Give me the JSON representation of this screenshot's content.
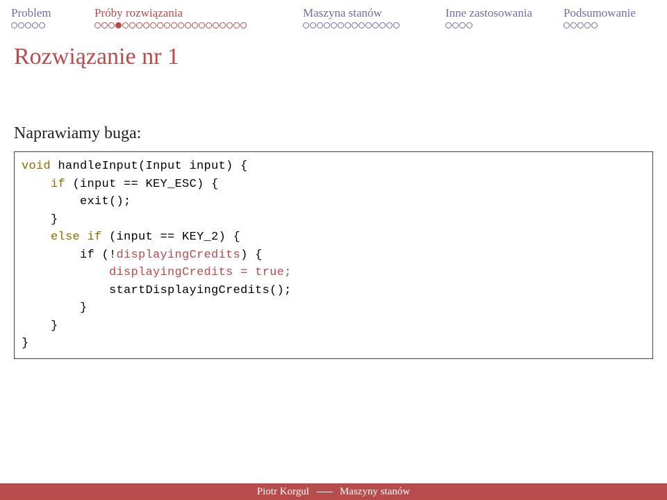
{
  "nav": {
    "items": [
      {
        "label": "Problem",
        "dots": 5,
        "active": false
      },
      {
        "label": "Próby rozwiązania",
        "dots": 22,
        "active": true,
        "current": 4
      },
      {
        "label": "Maszyna stanów",
        "dots": 14,
        "active": false
      },
      {
        "label": "Inne zastosowania",
        "dots": 4,
        "active": false
      },
      {
        "label": "Podsumowanie",
        "dots": 5,
        "active": false
      }
    ]
  },
  "title": "Rozwiązanie nr 1",
  "subhead": "Naprawiamy buga:",
  "code": {
    "l1a": "void",
    "l1b": " handleInput(Input input) {",
    "l2a": "    if",
    "l2b": " (input == KEY_ESC) {",
    "l3": "        exit();",
    "l4": "    }",
    "l5a": "    else if",
    "l5b": " (input == KEY_2) {",
    "l6a": "        if (!",
    "l6b": "displayingCredits",
    "l6c": ") {",
    "l7a": "            ",
    "l7b": "displayingCredits = ",
    "l7c": "true",
    "l7d": ";",
    "l8": "            startDisplayingCredits();",
    "l9": "        }",
    "l10": "    }",
    "l11": "}"
  },
  "footer": {
    "author": "Piotr Korgul",
    "talk": "Maszyny stanów"
  }
}
